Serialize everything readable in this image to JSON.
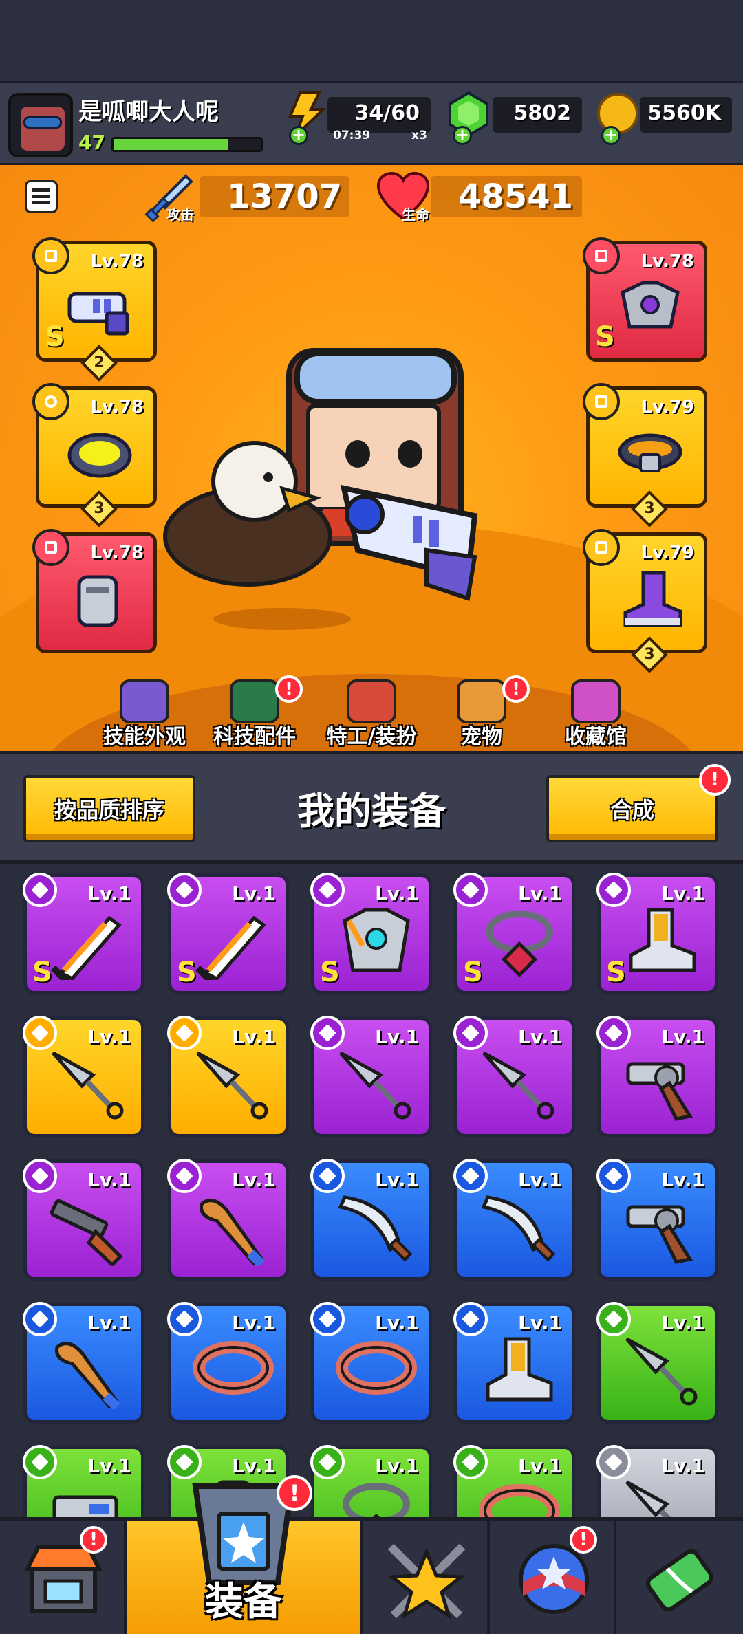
{
  "player": {
    "name": "是呱唧大人呢",
    "level": "47",
    "xp_fraction": 0.78
  },
  "resources": {
    "energy": "34/60",
    "energy_timer": "07:39",
    "energy_multiplier": "x3",
    "gems": "5802",
    "coins": "5560K"
  },
  "stats": {
    "attack_label": "攻击",
    "attack": "13707",
    "hp_label": "生命",
    "hp": "48541"
  },
  "equipped": [
    {
      "slot": "weapon",
      "level": "Lv.78",
      "rarity": "yellow",
      "grade": "S",
      "stars": "2"
    },
    {
      "slot": "necklace",
      "level": "Lv.78",
      "rarity": "yellow",
      "grade": "",
      "stars": "3"
    },
    {
      "slot": "gloves",
      "level": "Lv.78",
      "rarity": "red",
      "grade": "",
      "stars": ""
    },
    {
      "slot": "armor",
      "level": "Lv.78",
      "rarity": "red",
      "grade": "S",
      "stars": ""
    },
    {
      "slot": "belt",
      "level": "Lv.79",
      "rarity": "yellow",
      "grade": "",
      "stars": "3"
    },
    {
      "slot": "boots",
      "level": "Lv.79",
      "rarity": "yellow",
      "grade": "",
      "stars": "3"
    }
  ],
  "hero_tabs": [
    {
      "label": "技能外观",
      "icon": "skill-skin-icon",
      "alert": false
    },
    {
      "label": "科技配件",
      "icon": "tech-parts-icon",
      "alert": true
    },
    {
      "label": "特工/装扮",
      "icon": "agent-outfit-icon",
      "alert": false
    },
    {
      "label": "宠物",
      "icon": "pet-icon",
      "alert": true
    },
    {
      "label": "收藏馆",
      "icon": "collection-icon",
      "alert": false
    }
  ],
  "inventory": {
    "sort_label": "按品质排序",
    "title": "我的装备",
    "merge_label": "合成",
    "merge_alert": "!",
    "items": [
      {
        "level": "Lv.1",
        "rarity": "purple",
        "grade": "S",
        "icon": "sword-icon"
      },
      {
        "level": "Lv.1",
        "rarity": "purple",
        "grade": "S",
        "icon": "sword-icon"
      },
      {
        "level": "Lv.1",
        "rarity": "purple",
        "grade": "S",
        "icon": "armor-icon"
      },
      {
        "level": "Lv.1",
        "rarity": "purple",
        "grade": "S",
        "icon": "necklace-icon"
      },
      {
        "level": "Lv.1",
        "rarity": "purple",
        "grade": "S",
        "icon": "boots-icon"
      },
      {
        "level": "Lv.1",
        "rarity": "gold",
        "grade": "",
        "icon": "kunai-icon"
      },
      {
        "level": "Lv.1",
        "rarity": "gold",
        "grade": "",
        "icon": "kunai-icon"
      },
      {
        "level": "Lv.1",
        "rarity": "purple",
        "grade": "",
        "icon": "kunai-icon"
      },
      {
        "level": "Lv.1",
        "rarity": "purple",
        "grade": "",
        "icon": "kunai-icon"
      },
      {
        "level": "Lv.1",
        "rarity": "purple",
        "grade": "",
        "icon": "revolver-icon"
      },
      {
        "level": "Lv.1",
        "rarity": "purple",
        "grade": "",
        "icon": "shotgun-icon"
      },
      {
        "level": "Lv.1",
        "rarity": "purple",
        "grade": "",
        "icon": "bat-icon"
      },
      {
        "level": "Lv.1",
        "rarity": "blue",
        "grade": "",
        "icon": "machete-icon"
      },
      {
        "level": "Lv.1",
        "rarity": "blue",
        "grade": "",
        "icon": "machete-icon"
      },
      {
        "level": "Lv.1",
        "rarity": "blue",
        "grade": "",
        "icon": "revolver-icon"
      },
      {
        "level": "Lv.1",
        "rarity": "blue",
        "grade": "",
        "icon": "bat-icon"
      },
      {
        "level": "Lv.1",
        "rarity": "blue",
        "grade": "",
        "icon": "belt-icon"
      },
      {
        "level": "Lv.1",
        "rarity": "blue",
        "grade": "",
        "icon": "belt-icon"
      },
      {
        "level": "Lv.1",
        "rarity": "blue",
        "grade": "",
        "icon": "boots-icon"
      },
      {
        "level": "Lv.1",
        "rarity": "green",
        "grade": "",
        "icon": "kunai-icon"
      },
      {
        "level": "Lv.1",
        "rarity": "green",
        "grade": "",
        "icon": "gun-icon"
      },
      {
        "level": "Lv.1",
        "rarity": "green",
        "grade": "",
        "icon": "armor-icon"
      },
      {
        "level": "Lv.1",
        "rarity": "green",
        "grade": "",
        "icon": "necklace-icon"
      },
      {
        "level": "Lv.1",
        "rarity": "green",
        "grade": "",
        "icon": "belt-icon"
      },
      {
        "level": "Lv.1",
        "rarity": "gray",
        "grade": "",
        "icon": "kunai-icon"
      }
    ]
  },
  "bottom_nav": {
    "shop_alert": "!",
    "equip_label": "装备",
    "equip_alert": "!",
    "challenge_alert": "",
    "events_alert": "!",
    "evolve_alert": ""
  },
  "colors": {
    "purple": "#b13ae6",
    "gold": "#ffc21a",
    "blue": "#2a72f0",
    "green": "#5cc828",
    "gray": "#b4b8c2",
    "red": "#ee3a55"
  }
}
